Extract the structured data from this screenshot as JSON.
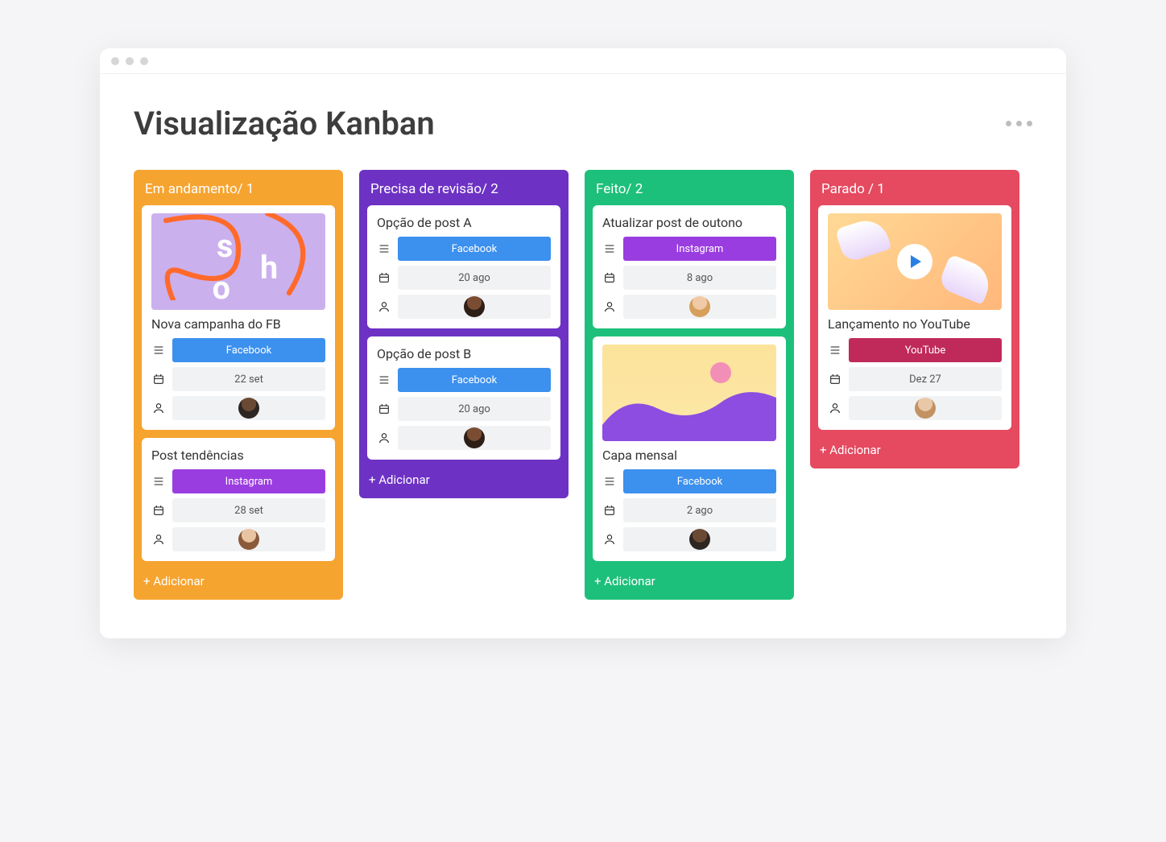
{
  "page": {
    "title": "Visualização Kanban"
  },
  "colors": {
    "orange": "#f6a430",
    "purple": "#6d32c4",
    "green": "#1dc07a",
    "red": "#e54a60",
    "facebook": "#3c90ee",
    "instagram": "#9a3de0",
    "youtube": "#c02a5a"
  },
  "addLabel": "+ Adicionar",
  "columns": [
    {
      "id": "in-progress",
      "header": "Em andamento/ 1",
      "cards": [
        {
          "title": "Nova campanha do FB",
          "channel": "Facebook",
          "channelKey": "fb",
          "date": "22 set",
          "thumb": "shop"
        },
        {
          "title": "Post tendências",
          "channel": "Instagram",
          "channelKey": "ig",
          "date": "28 set"
        }
      ]
    },
    {
      "id": "needs-review",
      "header": "Precisa de revisão/ 2",
      "cards": [
        {
          "title": "Opção de post A",
          "channel": "Facebook",
          "channelKey": "fb",
          "date": "20 ago"
        },
        {
          "title": "Opção de post B",
          "channel": "Facebook",
          "channelKey": "fb",
          "date": "20 ago"
        }
      ]
    },
    {
      "id": "done",
      "header": "Feito/ 2",
      "cards": [
        {
          "title": "Atualizar post de outono",
          "channel": "Instagram",
          "channelKey": "ig",
          "date": "8 ago"
        },
        {
          "title": "Capa mensal",
          "channel": "Facebook",
          "channelKey": "fb",
          "date": "2 ago",
          "thumb": "wave"
        }
      ]
    },
    {
      "id": "stopped",
      "header": "Parado / 1",
      "cards": [
        {
          "title": "Lançamento no YouTube",
          "channel": "YouTube",
          "channelKey": "yt",
          "date": "Dez 27",
          "thumb": "video"
        }
      ]
    }
  ]
}
